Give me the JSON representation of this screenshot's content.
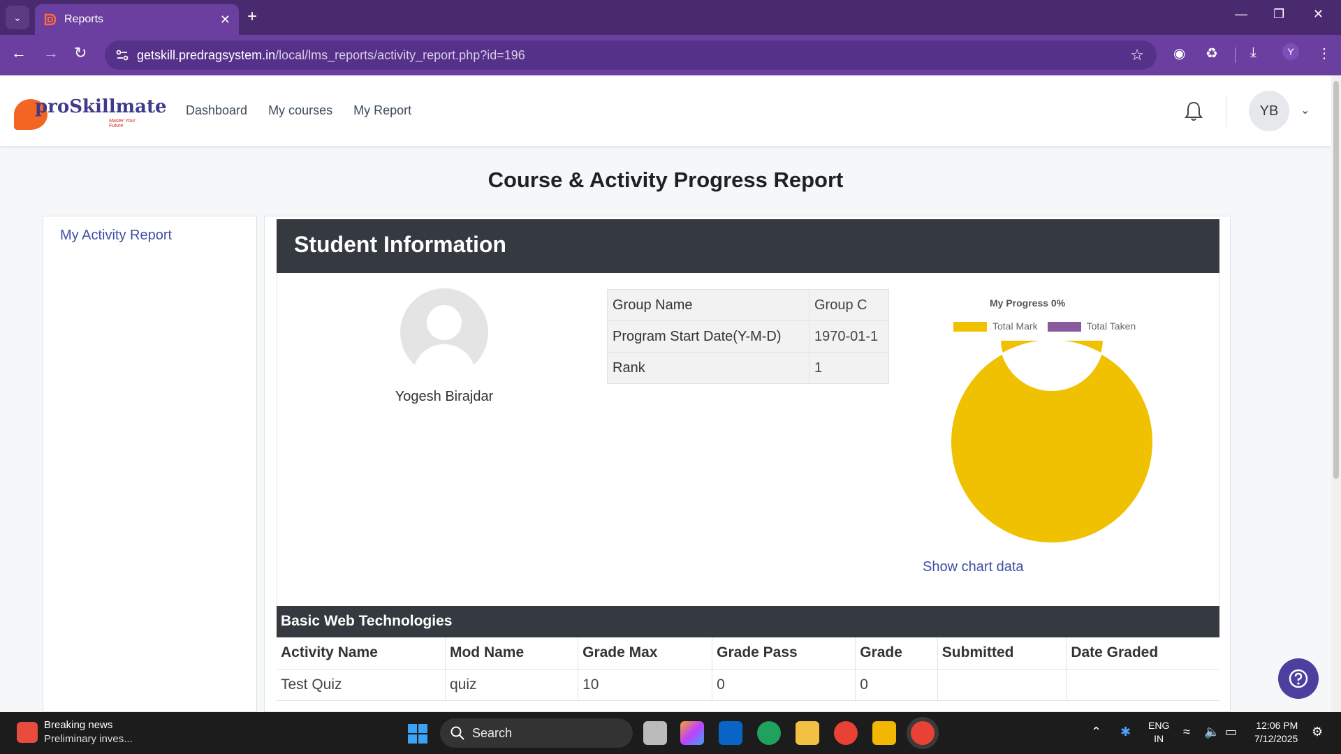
{
  "browser": {
    "tab_title": "Reports",
    "url_host": "getskill.predragsystem.in",
    "url_path": "/local/lms_reports/activity_report.php?id=196",
    "profile_initial": "Y"
  },
  "site": {
    "logo_text": "proSkillmate",
    "logo_tagline": "Master Your Future",
    "nav": [
      "Dashboard",
      "My courses",
      "My Report"
    ],
    "user_initials": "YB"
  },
  "page": {
    "title": "Course & Activity Progress Report",
    "sidebar_link": "My Activity Report"
  },
  "student_info": {
    "header": "Student Information",
    "name": "Yogesh Birajdar",
    "rows": [
      {
        "key": "Group Name",
        "value": "Group C"
      },
      {
        "key": "Program Start Date(Y-M-D)",
        "value": "1970-01-1"
      },
      {
        "key": "Rank",
        "value": "1"
      }
    ]
  },
  "chart_data": {
    "type": "pie",
    "title": "My Progress 0%",
    "categories": [
      "Total Mark",
      "Total Taken"
    ],
    "values": [
      100,
      0
    ],
    "colors": [
      "#f0c100",
      "#8a5a9e"
    ],
    "legend_position": "top",
    "show_data_link": "Show chart data"
  },
  "course": {
    "name": "Basic Web Technologies",
    "columns": [
      "Activity Name",
      "Mod Name",
      "Grade Max",
      "Grade Pass",
      "Grade",
      "Submitted",
      "Date Graded"
    ],
    "rows": [
      [
        "Test Quiz",
        "quiz",
        "10",
        "0",
        "0",
        "",
        ""
      ]
    ]
  },
  "taskbar": {
    "news_title": "Breaking news",
    "news_sub": "Preliminary inves...",
    "search_label": "Search",
    "lang_line1": "ENG",
    "lang_line2": "IN",
    "time": "12:06 PM",
    "date": "7/12/2025"
  }
}
